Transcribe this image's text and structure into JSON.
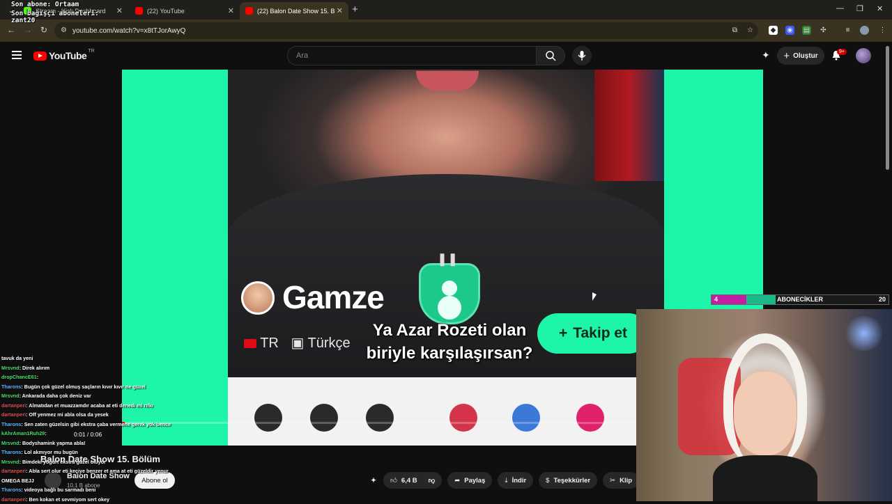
{
  "browser": {
    "tabs": [
      {
        "title": "Stream - Kick Dashboard",
        "color": "#53fc18"
      },
      {
        "title": "(22) YouTube",
        "color": "#ff0000"
      },
      {
        "title": "(22) Balon Date Show 15. B",
        "color": "#ff0000"
      }
    ],
    "url": "youtube.com/watch?v=x8tTJorAwyQ"
  },
  "stream_overlay": {
    "line1": "Son abone: Ortaam",
    "line2": "Son bağışçı aboneleri:",
    "line3": "zant20"
  },
  "youtube": {
    "logo_text": "YouTube",
    "country": "TR",
    "search_placeholder": "Ara",
    "create_label": "Oluştur",
    "notif_badge": "9+"
  },
  "video": {
    "person_name": "Gamze",
    "lang_code": "TR",
    "lang_name": "Türkçe",
    "follow_label": "Takip et",
    "subtitle_line1": "Ya Azar Rozeti olan",
    "subtitle_line2": "biriyle karşılaşırsan?",
    "time": "0:01 / 0:06",
    "progress": 0.005,
    "title": "Balon Date Show 15. Bölüm",
    "channel_name": "Balon Date Show",
    "channel_subs": "10,1 B abone",
    "subscribe_label": "Abone ol",
    "like_count": "6,4 B",
    "share_label": "Paylaş",
    "download_label": "İndir",
    "thanks_label": "Teşekkürler",
    "clip_label": "Klip"
  },
  "chat": [
    {
      "user": "",
      "text": "tavuk da yeni",
      "color": "u1"
    },
    {
      "user": "Mrsvnd",
      "text": ": Direk alırım",
      "color": "u1"
    },
    {
      "user": "dropChancE61",
      "text": ":",
      "color": "u1"
    },
    {
      "user": "Tharons",
      "text": ": Bugün çok güzel olmuş saçların kıvır kıvır ne güzel",
      "color": "u2"
    },
    {
      "user": "Mrsvnd",
      "text": ": Ankarada daha çok deniz var",
      "color": "u1"
    },
    {
      "user": "dartanperi",
      "text": ": Almatıdan et muazzamdır acaba at eti denedi mi rıfkı",
      "color": "u3"
    },
    {
      "user": "dartanperi",
      "text": ": Off yenmez mi abla olsa da yesek",
      "color": "u3"
    },
    {
      "user": "Tharons",
      "text": ": Sen zaten güzelsin gibi ekstra çaba vermene gerek yok bence",
      "color": "u2"
    },
    {
      "user": "kAhrAman1Ruh29",
      "text": ":",
      "color": "u1"
    },
    {
      "user": "Mrsvnd",
      "text": ": Bodyshamink yapma abla!",
      "color": "u1"
    },
    {
      "user": "Tharons",
      "text": ": Lol akmıyor mu bugün",
      "color": "u2"
    },
    {
      "user": "Mrsvnd",
      "text": ": Bimdeki yoğurt ekstra güzel oluyor",
      "color": "u1"
    },
    {
      "user": "dartanperi",
      "text": ": Abla sert olur eti keçiye benzer et ama at eti güzeldir yenur",
      "color": "u3"
    },
    {
      "user": "OMEGA BEJJ",
      "text": "",
      "color": "m"
    },
    {
      "user": "Tharons",
      "text": ": videoya bağlı bu sarmadı beni",
      "color": "u2"
    },
    {
      "user": "dartanperi",
      "text": ": Ben kokan et sevmiyom sert okey",
      "color": "u3"
    }
  ],
  "goal": {
    "current": "4",
    "label": "ABONECİKLER",
    "max": "20",
    "fill_color": "#c21fa3"
  }
}
